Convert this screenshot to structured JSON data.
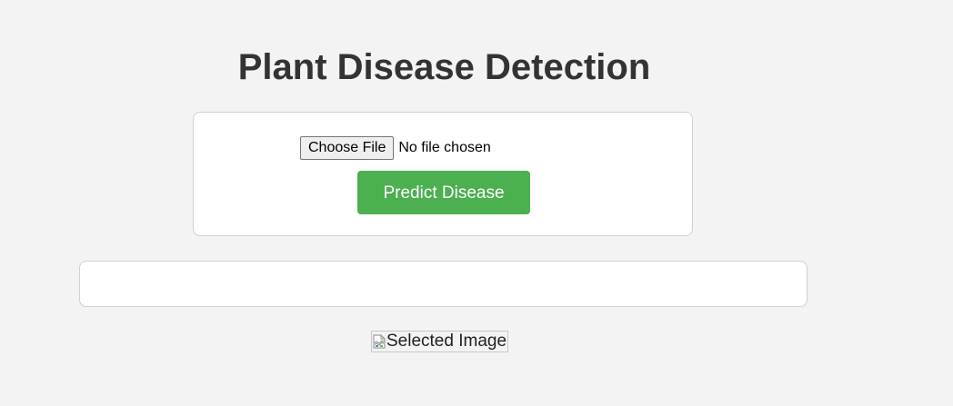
{
  "page": {
    "title": "Plant Disease Detection"
  },
  "upload": {
    "choose_file_label": "Choose File",
    "file_status": "No file chosen",
    "predict_label": "Predict Disease"
  },
  "result": {
    "text": ""
  },
  "preview": {
    "alt_text": "Selected Image",
    "icon": "broken-image-icon"
  },
  "colors": {
    "background": "#f3f3f3",
    "title": "#333333",
    "predict_button": "#4caf50",
    "card": "#ffffff"
  }
}
